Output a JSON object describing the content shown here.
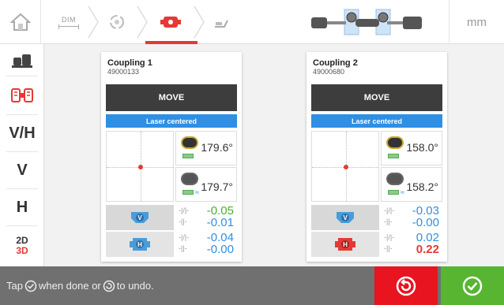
{
  "toolbar": {
    "home_icon": "home-icon",
    "dim_label": "DIM",
    "unit": "mm"
  },
  "sidebar": {
    "items": [
      {
        "name": "machines-icon"
      },
      {
        "name": "coupling-view-icon"
      },
      {
        "label": "V/H"
      },
      {
        "label": "V"
      },
      {
        "label": "H"
      },
      {
        "label_top": "2D",
        "label_bottom": "3D"
      }
    ]
  },
  "couplings": [
    {
      "title": "Coupling 1",
      "id": "49000133",
      "move_label": "MOVE",
      "status": "Laser centered",
      "angle1": "179.6°",
      "angle2": "179.7°",
      "v_values": [
        "-0.05",
        "-0.01"
      ],
      "h_values": [
        "-0.04",
        "-0.00"
      ],
      "v_color": "#2f8fe3",
      "h_color": "#2f8fe3"
    },
    {
      "title": "Coupling 2",
      "id": "49000680",
      "move_label": "MOVE",
      "status": "Laser centered",
      "angle1": "158.0°",
      "angle2": "158.2°",
      "v_values": [
        "-0.03",
        "-0.00"
      ],
      "h_values": [
        "0.02",
        "0.22"
      ],
      "v_color": "#2f8fe3",
      "h_color": "#e53935"
    }
  ],
  "footer": {
    "hint_a": "Tap",
    "hint_b": "when done or",
    "hint_c": "to undo."
  },
  "colors": {
    "accent_red": "#e8141f",
    "accent_green": "#57b532",
    "laser_blue": "#2f8fe3",
    "good_green": "#4caf2a",
    "bad_red": "#e53935"
  }
}
